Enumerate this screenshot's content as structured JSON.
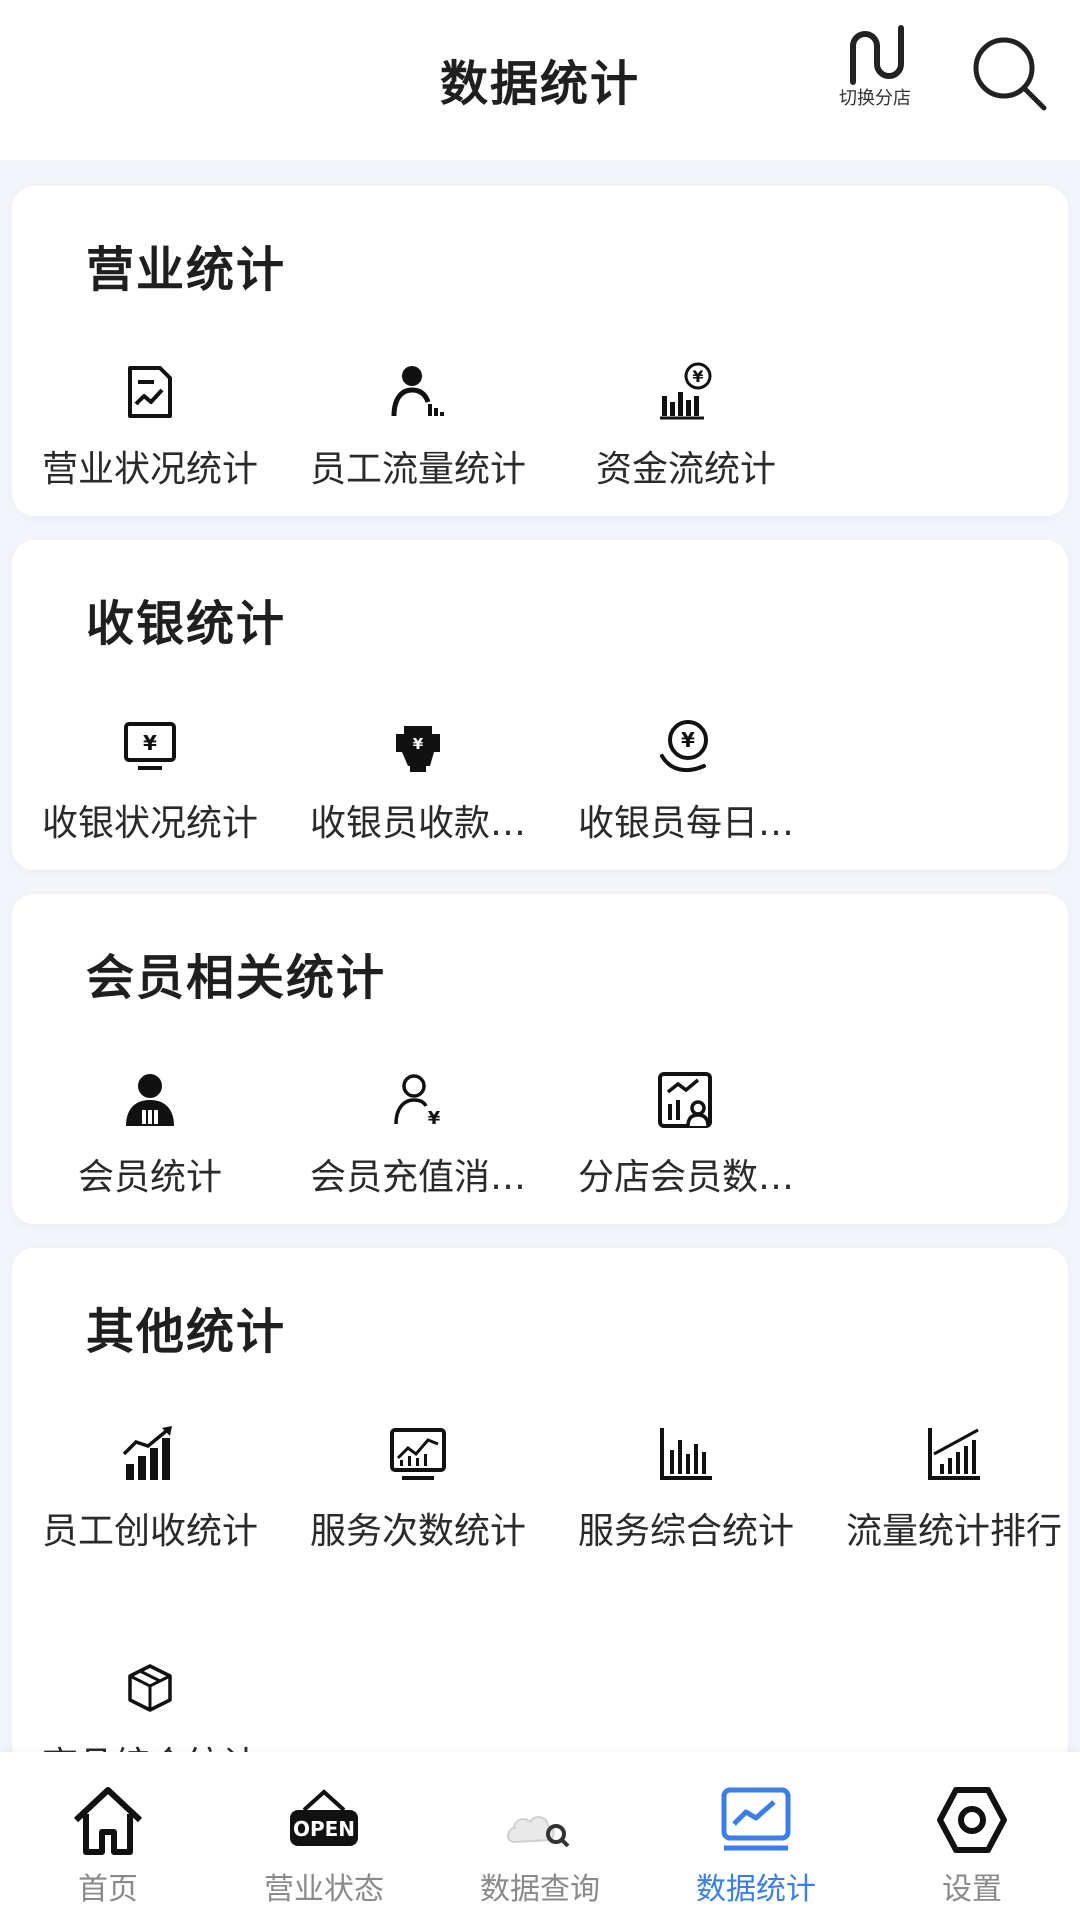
{
  "header": {
    "title": "数据统计",
    "switch_branch_label": "切换分店"
  },
  "sections": [
    {
      "title": "营业统计",
      "items": [
        {
          "label": "营业状况统计",
          "icon": "report-icon"
        },
        {
          "label": "员工流量统计",
          "icon": "staff-chart-icon"
        },
        {
          "label": "资金流统计",
          "icon": "money-chart-icon"
        }
      ]
    },
    {
      "title": "收银统计",
      "items": [
        {
          "label": "收银状况统计",
          "icon": "monitor-yen-icon"
        },
        {
          "label": "收银员收款…",
          "icon": "hand-cash-icon"
        },
        {
          "label": "收银员每日…",
          "icon": "coin-hand-icon"
        }
      ]
    },
    {
      "title": "会员相关统计",
      "items": [
        {
          "label": "会员统计",
          "icon": "member-icon"
        },
        {
          "label": "会员充值消…",
          "icon": "member-yen-icon"
        },
        {
          "label": "分店会员数…",
          "icon": "branch-member-chart-icon"
        }
      ]
    },
    {
      "title": "其他统计",
      "items": [
        {
          "label": "员工创收统计",
          "icon": "growth-bars-icon"
        },
        {
          "label": "服务次数统计",
          "icon": "screen-chart-icon"
        },
        {
          "label": "服务综合统计",
          "icon": "bar-chart-icon"
        },
        {
          "label": "流量统计排行",
          "icon": "rank-chart-icon"
        },
        {
          "label": "商品综合统计",
          "icon": "box-icon"
        }
      ]
    }
  ],
  "tabbar": {
    "active": "数据统计",
    "tabs": [
      {
        "label": "首页",
        "icon": "home-icon"
      },
      {
        "label": "营业状态",
        "icon": "open-sign-icon"
      },
      {
        "label": "数据查询",
        "icon": "search-cloud-icon"
      },
      {
        "label": "数据统计",
        "icon": "trend-chart-icon"
      },
      {
        "label": "设置",
        "icon": "hexagon-settings-icon"
      }
    ]
  },
  "colors": {
    "accent": "#3b7ee8",
    "background": "#f3f5fa",
    "card": "#ffffff",
    "inactive_tab": "#8a8a8a"
  }
}
